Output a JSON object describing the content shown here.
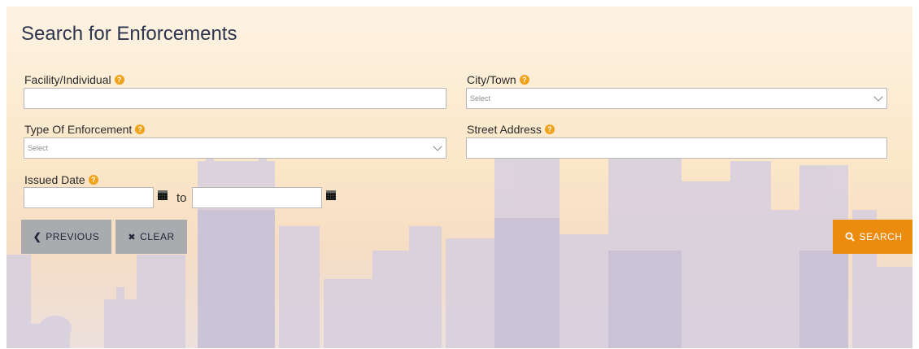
{
  "form": {
    "title": "Search for Enforcements",
    "facility_label": "Facility/Individual",
    "facility_value": "",
    "city_label": "City/Town",
    "city_placeholder": "Select",
    "type_label": "Type Of Enforcement",
    "type_placeholder": "Select",
    "street_label": "Street Address",
    "street_value": "",
    "issued_label": "Issued Date",
    "date_from": "",
    "date_to": "",
    "to_text": "to",
    "help_glyph": "?"
  },
  "buttons": {
    "previous_label": "PREVIOUS",
    "previous_icon": "❮",
    "clear_label": "CLEAR",
    "clear_icon": "✖",
    "search_label": "SEARCH",
    "search_icon": "search-icon"
  },
  "colors": {
    "accent": "#ec8c0e",
    "help": "#f0a21a",
    "title": "#2e3550",
    "gray_button": "#a9abaf"
  }
}
